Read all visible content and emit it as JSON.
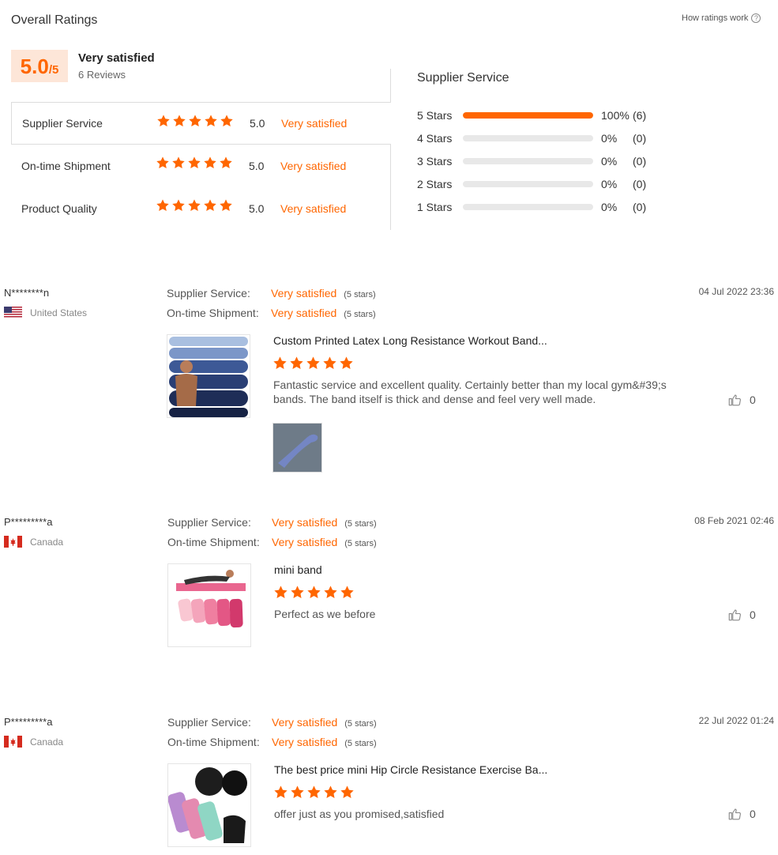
{
  "header": {
    "title": "Overall Ratings",
    "how_ratings_work": "How ratings work",
    "help_icon_glyph": "?"
  },
  "overall": {
    "score": "5.0",
    "score_suffix": "/5",
    "label": "Very satisfied",
    "review_count": "6 Reviews"
  },
  "metrics": [
    {
      "name": "Supplier Service",
      "value": "5.0",
      "text": "Very satisfied",
      "stars": 5
    },
    {
      "name": "On-time Shipment",
      "value": "5.0",
      "text": "Very satisfied",
      "stars": 5
    },
    {
      "name": "Product Quality",
      "value": "5.0",
      "text": "Very satisfied",
      "stars": 5
    }
  ],
  "distribution": {
    "title": "Supplier Service",
    "rows": [
      {
        "label": "5  Stars",
        "fraction": 1.0,
        "percent": "100%",
        "count": "(6)"
      },
      {
        "label": "4  Stars",
        "fraction": 0.0,
        "percent": "0%",
        "count": "(0)"
      },
      {
        "label": "3  Stars",
        "fraction": 0.0,
        "percent": "0%",
        "count": "(0)"
      },
      {
        "label": "2  Stars",
        "fraction": 0.0,
        "percent": "0%",
        "count": "(0)"
      },
      {
        "label": "1  Stars",
        "fraction": 0.0,
        "percent": "0%",
        "count": "(0)"
      }
    ]
  },
  "reviews": [
    {
      "name": "N********n",
      "country": "United States",
      "flag": "us-flag",
      "date": "04 Jul 2022 23:36",
      "supplier_label": "Supplier Service:",
      "supplier_value": "Very satisfied",
      "supplier_sub": "(5 stars)",
      "shipment_label": "On-time Shipment:",
      "shipment_value": "Very satisfied",
      "shipment_sub": "(5 stars)",
      "product_title": "Custom Printed Latex Long Resistance Workout Band...",
      "stars": 5,
      "text": "Fantastic service and excellent quality. Certainly better than my local gym&#39;s bands. The band itself is thick and dense and feel very well made.",
      "likes": "0"
    },
    {
      "name": "P*********a",
      "country": "Canada",
      "flag": "canada-flag",
      "date": "08 Feb 2021 02:46",
      "supplier_label": "Supplier Service:",
      "supplier_value": "Very satisfied",
      "supplier_sub": "(5 stars)",
      "shipment_label": "On-time Shipment:",
      "shipment_value": "Very satisfied",
      "shipment_sub": "(5 stars)",
      "product_title": "mini band",
      "stars": 5,
      "text": "Perfect as we before",
      "likes": "0"
    },
    {
      "name": "P*********a",
      "country": "Canada",
      "flag": "canada-flag",
      "date": "22 Jul 2022 01:24",
      "supplier_label": "Supplier Service:",
      "supplier_value": "Very satisfied",
      "supplier_sub": "(5 stars)",
      "shipment_label": "On-time Shipment:",
      "shipment_value": "Very satisfied",
      "shipment_sub": "(5 stars)",
      "product_title": "The best price mini Hip Circle Resistance Exercise Ba...",
      "stars": 5,
      "text": "offer just as you promised,satisfied",
      "likes": "0"
    }
  ],
  "colors": {
    "accent": "#ff6600",
    "score_bg": "#fde6d8",
    "track": "#e8e8e8"
  }
}
